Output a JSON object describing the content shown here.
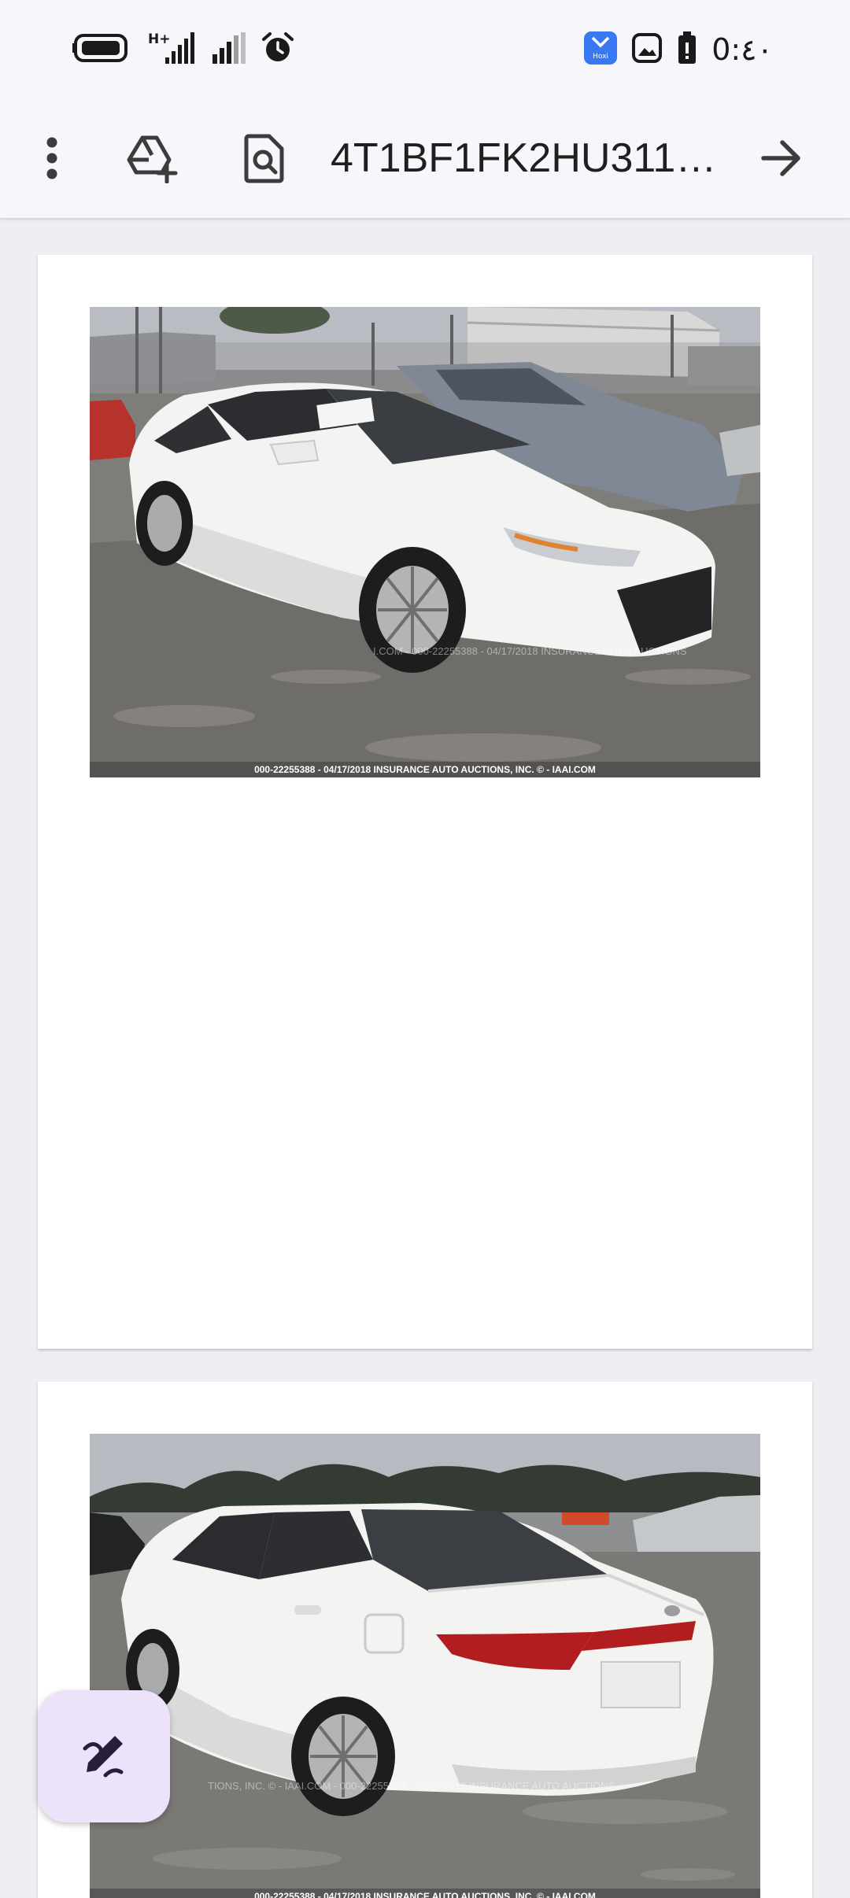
{
  "status_bar": {
    "network_label": "H+",
    "notification_app_label": "Hoxi",
    "time": "0:٤٠"
  },
  "app_bar": {
    "title": "4T1BF1FK2HU3115...",
    "icons": [
      "more-vert-icon",
      "add-to-drive-icon",
      "find-in-page-icon",
      "arrow-forward-icon"
    ]
  },
  "pages": [
    {
      "photo_caption": "000-22255388 - 04/17/2018 INSURANCE AUTO AUCTIONS, INC. © - IAAI.COM",
      "watermark": "I.COM - 000-22255388 - 04/17/2018 INSURANCE AUTO AUCTIONS",
      "car_color": "#f3f3f1",
      "view": "front-three-quarter"
    },
    {
      "photo_caption": "000-22255388 - 04/17/2018 INSURANCE AUTO AUCTIONS, INC. © - IAAI.COM",
      "watermark": "TIONS, INC. © - IAAI.COM - 000-22255388 - 04/17/2018 INSURANCE AUTO AUCTIONS",
      "car_color": "#f3f3f1",
      "view": "rear-three-quarter"
    }
  ],
  "fab": {
    "icon": "edit-draw-icon"
  }
}
